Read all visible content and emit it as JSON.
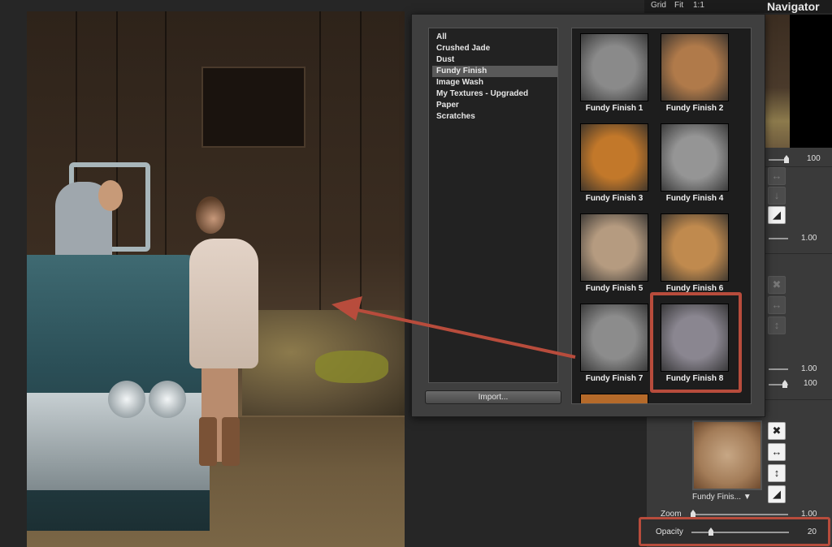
{
  "navigator": {
    "links": [
      "Grid",
      "Fit",
      "1:1"
    ],
    "title": "Navigator"
  },
  "popup": {
    "categories": [
      "All",
      "Crushed Jade",
      "Dust",
      "Fundy Finish",
      "Image Wash",
      "My Textures - Upgraded",
      "Paper",
      "Scratches"
    ],
    "selected_category": "Fundy Finish",
    "import_label": "Import...",
    "textures": [
      {
        "label": "Fundy Finish  1",
        "color": "#8a8a8a"
      },
      {
        "label": "Fundy Finish  2",
        "color": "#b07a4a"
      },
      {
        "label": "Fundy Finish  3",
        "color": "#c2782a"
      },
      {
        "label": "Fundy Finish  4",
        "color": "#959595"
      },
      {
        "label": "Fundy Finish  5",
        "color": "#b59b80"
      },
      {
        "label": "Fundy Finish  6",
        "color": "#c08a4e"
      },
      {
        "label": "Fundy Finish  7",
        "color": "#8c8c8c"
      },
      {
        "label": "Fundy Finish  8",
        "color": "#8a8690"
      }
    ]
  },
  "right_panel": {
    "values": [
      "100",
      "1.00",
      "1.00",
      "100",
      "1.00"
    ],
    "texture_name": "Fundy Finis... ▼",
    "zoom_label": "Zoom",
    "opacity_label": "Opacity",
    "opacity_value": "20",
    "opacity_level": 0.2
  },
  "colors": {
    "highlight": "#b84c3c",
    "panel": "#3a3a3a"
  }
}
